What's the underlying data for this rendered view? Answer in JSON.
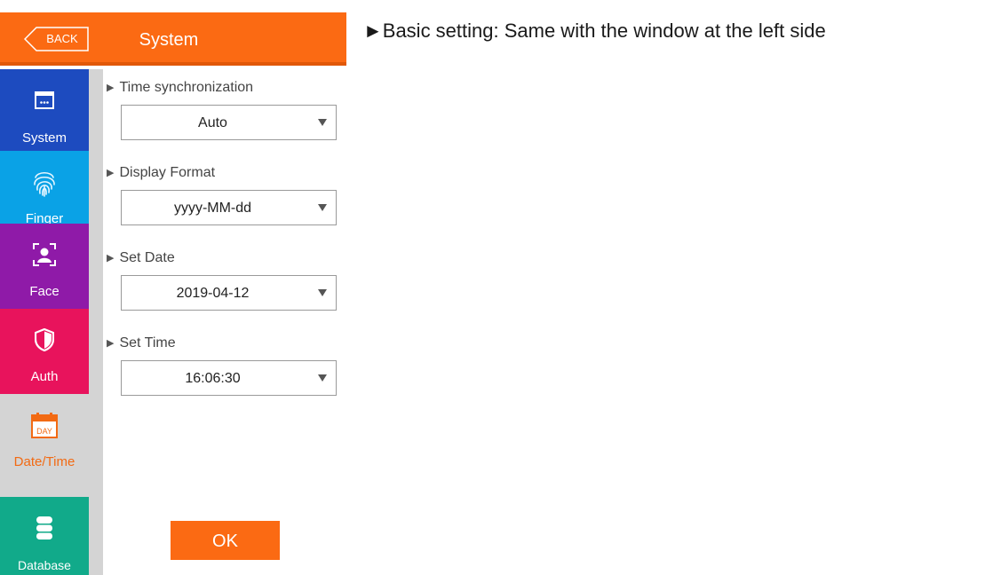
{
  "header": {
    "back_label": "BACK",
    "title": "System"
  },
  "sidebar": {
    "items": [
      {
        "label": "System",
        "icon": "window-icon",
        "color": "#1d4bbf"
      },
      {
        "label": "Finger",
        "icon": "fingerprint-icon",
        "color": "#0aa2e6"
      },
      {
        "label": "Face",
        "icon": "face-scan-icon",
        "color": "#8f1aa8"
      },
      {
        "label": "Auth",
        "icon": "shield-icon",
        "color": "#e8135c"
      },
      {
        "label": "Date/Time",
        "icon": "calendar-day-icon",
        "color": "#f26a13",
        "active": true
      },
      {
        "label": "Database",
        "icon": "database-icon",
        "color": "#11aa8a"
      }
    ]
  },
  "calendar_icon_text": "DAY",
  "fields": [
    {
      "label": "Time synchronization",
      "value": "Auto"
    },
    {
      "label": "Display Format",
      "value": "yyyy-MM-dd"
    },
    {
      "label": "Set Date",
      "value": "2019-04-12"
    },
    {
      "label": "Set Time",
      "value": "16:06:30"
    }
  ],
  "ok_label": "OK",
  "note": "►Basic setting: Same with the window at the left side",
  "colors": {
    "accent": "#fb6a13",
    "sidebar_bg": "#d4d4d4"
  }
}
